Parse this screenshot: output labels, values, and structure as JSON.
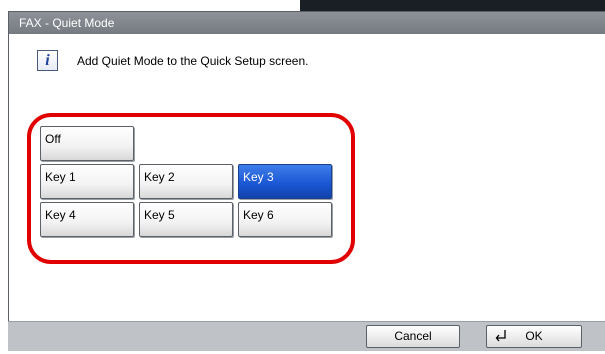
{
  "window": {
    "title": "FAX - Quiet Mode"
  },
  "info": {
    "icon": "info-icon",
    "glyph": "i",
    "message": "Add Quiet Mode to the Quick Setup screen."
  },
  "keys": {
    "off": "Off",
    "key1": "Key 1",
    "key2": "Key 2",
    "key3": "Key 3",
    "key4": "Key 4",
    "key5": "Key 5",
    "key6": "Key 6",
    "selected": "Key 3"
  },
  "footer": {
    "cancel_label": "Cancel",
    "ok_label": "OK",
    "ok_icon": "enter-icon"
  },
  "colors": {
    "selected_key": "#1955d2",
    "highlight_ring": "#e10000",
    "titlebar": "#80848a"
  }
}
